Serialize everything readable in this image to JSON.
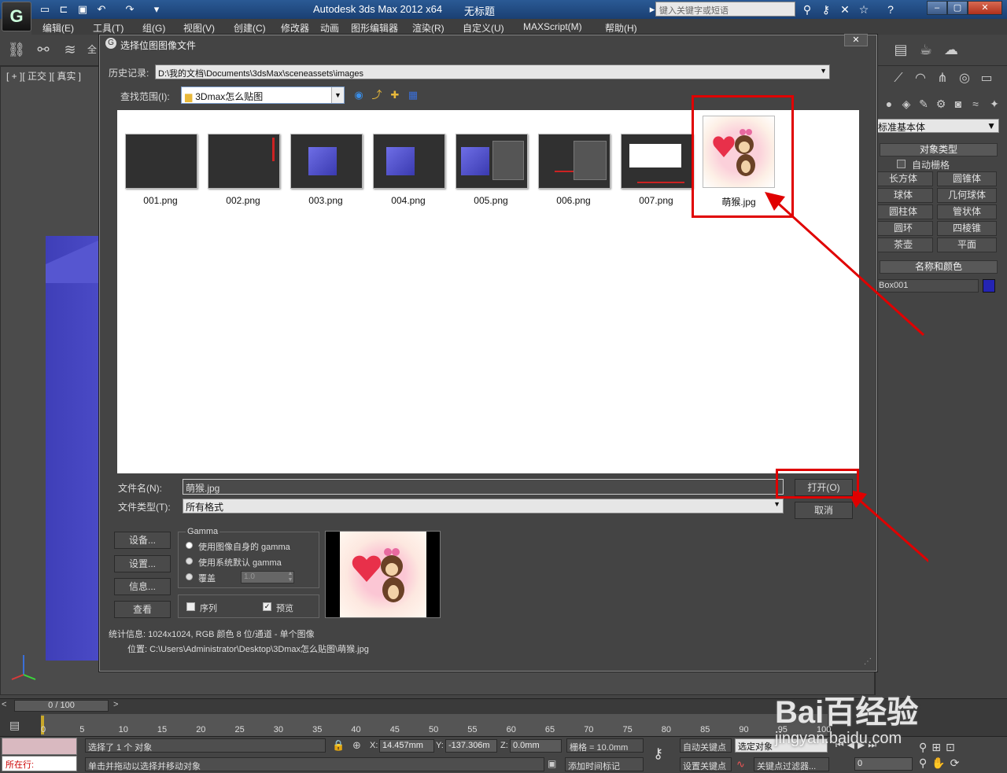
{
  "app": {
    "title": "Autodesk 3ds Max  2012 x64",
    "doc_title": "无标题",
    "search_placeholder": "键入关键字或短语"
  },
  "menu": [
    "编辑(E)",
    "工具(T)",
    "组(G)",
    "视图(V)",
    "创建(C)",
    "修改器",
    "动画",
    "图形编辑器",
    "渲染(R)",
    "自定义(U)",
    "MAXScript(M)",
    "帮助(H)"
  ],
  "viewport": {
    "label": "[ + ][ 正交 ][ 真实 ]"
  },
  "command_panel": {
    "category": "标准基本体",
    "object_type_title": "对象类型",
    "auto_grid": "自动栅格",
    "buttons": [
      "长方体",
      "圆锥体",
      "球体",
      "几何球体",
      "圆柱体",
      "管状体",
      "圆环",
      "四棱锥",
      "茶壶",
      "平面"
    ],
    "name_color_title": "名称和颜色",
    "object_name": "Box001",
    "object_color": "#2424b4"
  },
  "dialog": {
    "title": "选择位图图像文件",
    "history_label": "历史记录:",
    "history_path": "D:\\我的文档\\Documents\\3dsMax\\sceneassets\\images",
    "look_in_label": "查找范围(I):",
    "look_in_value": "3Dmax怎么贴图",
    "files": [
      "001.png",
      "002.png",
      "003.png",
      "004.png",
      "005.png",
      "006.png",
      "007.png",
      "萌猴.jpg"
    ],
    "filename_label": "文件名(N):",
    "filename_value": "萌猴.jpg",
    "filetype_label": "文件类型(T):",
    "filetype_value": "所有格式",
    "open_button": "打开(O)",
    "cancel_button": "取消",
    "side_buttons": [
      "设备...",
      "设置...",
      "信息...",
      "查看"
    ],
    "gamma_title": "Gamma",
    "gamma_options": [
      "使用图像自身的 gamma",
      "使用系统默认 gamma",
      "覆盖"
    ],
    "gamma_value": "1.0",
    "sequence_label": "序列",
    "preview_label": "预览",
    "stats": "统计信息: 1024x1024, RGB 颜色 8 位/通道 - 单个图像",
    "location": "位置: C:\\Users\\Administrator\\Desktop\\3Dmax怎么贴图\\萌猴.jpg"
  },
  "timeline": {
    "frame": "0 / 100",
    "ticks": [
      "0",
      "5",
      "10",
      "15",
      "20",
      "25",
      "30",
      "35",
      "40",
      "45",
      "50",
      "55",
      "60",
      "65",
      "70",
      "75",
      "80",
      "85",
      "90",
      "95",
      "100"
    ]
  },
  "status": {
    "running": "所在行:",
    "selection": "选择了 1 个 对象",
    "prompt": "单击并拖动以选择并移动对象",
    "x_label": "X:",
    "x_value": "14.457mm",
    "y_label": "Y:",
    "y_value": "-137.306m",
    "z_label": "Z:",
    "z_value": "0.0mm",
    "grid": "栅格 = 10.0mm",
    "add_time_tag": "添加时间标记",
    "auto_key": "自动关键点",
    "set_key": "设置关键点",
    "selected_object": "选定对象",
    "key_filters": "关键点过滤器...",
    "frame_field": "0"
  },
  "watermark": {
    "text": "Bai百经验",
    "url": "jingyan.baidu.com"
  }
}
